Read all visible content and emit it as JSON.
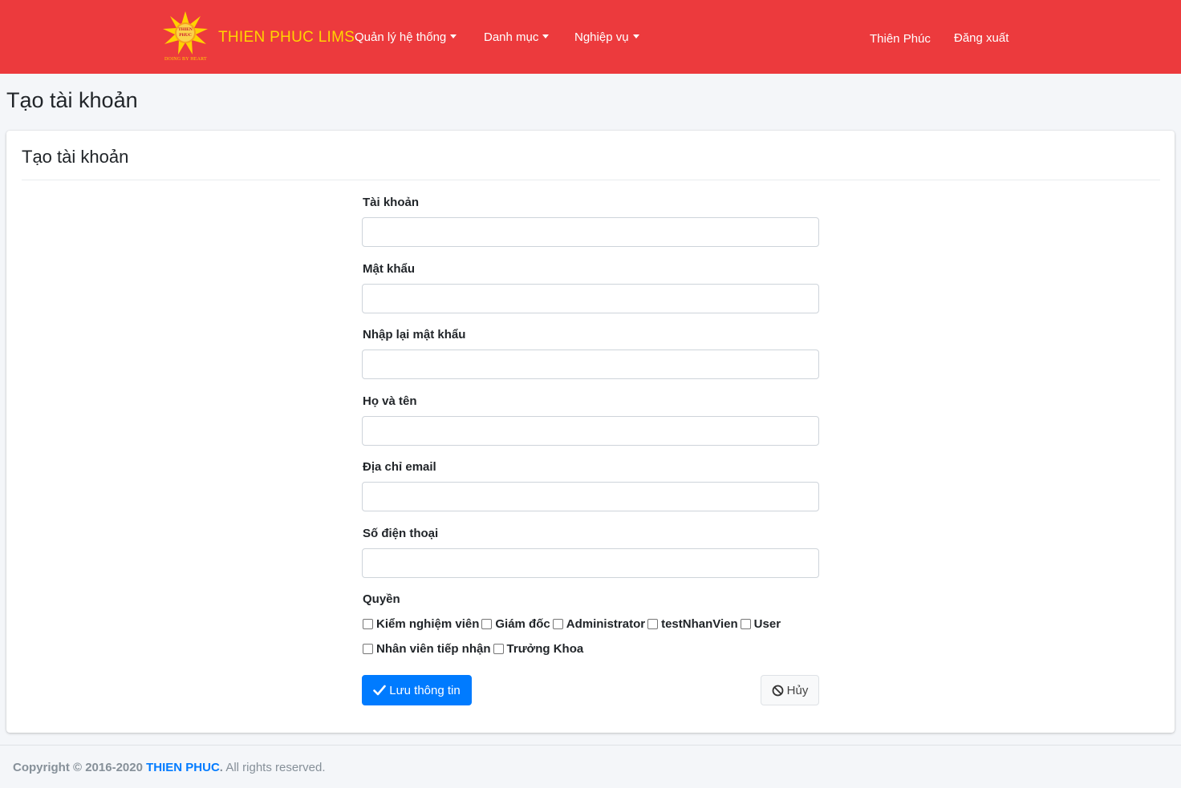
{
  "navbar": {
    "logo": {
      "icon": "thien-phuc-sun-logo",
      "top_text": "THIEN",
      "sub_text": "PHUC",
      "tagline": "DOING BY HEART"
    },
    "brand": "THIEN PHUC LIMS",
    "menus": [
      {
        "label": "Quản lý hệ thống"
      },
      {
        "label": "Danh mục"
      },
      {
        "label": "Nghiệp vụ"
      }
    ],
    "user_name": "Thiên Phúc",
    "logout_label": "Đăng xuất",
    "colors": {
      "background": "#ec3a3d",
      "brand": "#ffd500"
    }
  },
  "page_title": "Tạo tài khoản",
  "card": {
    "title": "Tạo tài khoản",
    "fields": [
      {
        "label": "Tài khoản",
        "value": ""
      },
      {
        "label": "Mật khẩu",
        "value": ""
      },
      {
        "label": "Nhập lại mật khẩu",
        "value": ""
      },
      {
        "label": "Họ và tên",
        "value": ""
      },
      {
        "label": "Địa chỉ email",
        "value": ""
      },
      {
        "label": "Số điện thoại",
        "value": ""
      }
    ],
    "roles_label": "Quyền",
    "roles": [
      {
        "label": "Kiểm nghiệm viên",
        "checked": false
      },
      {
        "label": "Giám đốc",
        "checked": false
      },
      {
        "label": "Administrator",
        "checked": false
      },
      {
        "label": "testNhanVien",
        "checked": false
      },
      {
        "label": "User",
        "checked": false
      },
      {
        "label": "Nhân viên tiếp nhận",
        "checked": false
      },
      {
        "label": "Trưởng Khoa",
        "checked": false
      }
    ],
    "save_button": {
      "label": "Lưu thông tin",
      "icon": "check-icon",
      "color": "#007bff"
    },
    "cancel_button": {
      "label": "Hủy",
      "icon": "ban-icon"
    }
  },
  "footer": {
    "prefix": "Copyright © 2016-2020",
    "brand": "THIEN PHUC",
    "suffix": "All rights reserved."
  }
}
